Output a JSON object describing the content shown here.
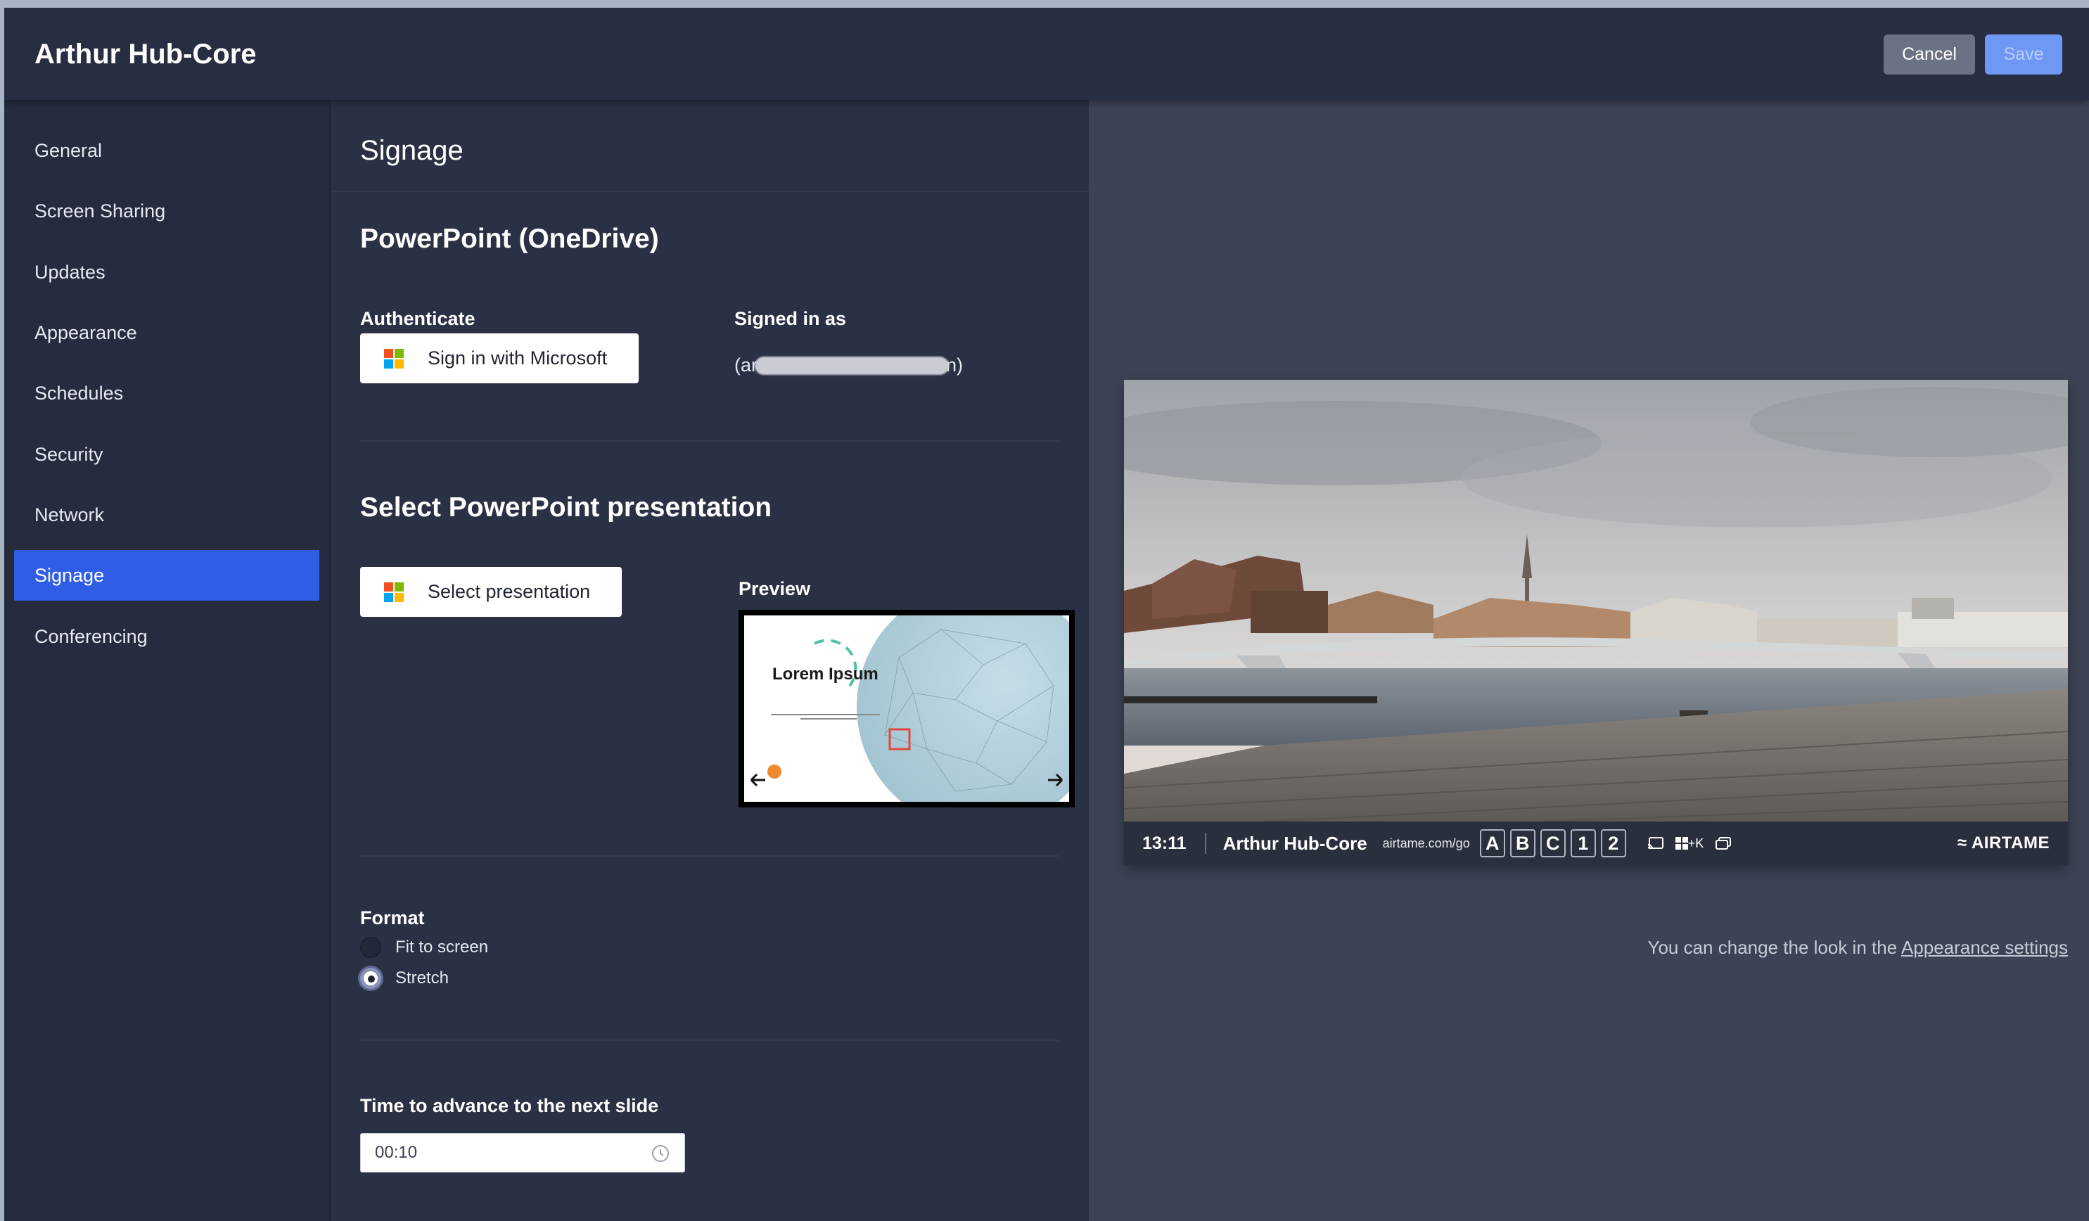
{
  "header": {
    "title": "Arthur Hub-Core",
    "cancel_label": "Cancel",
    "save_label": "Save"
  },
  "sidebar": {
    "items": [
      {
        "label": "General"
      },
      {
        "label": "Screen Sharing"
      },
      {
        "label": "Updates"
      },
      {
        "label": "Appearance"
      },
      {
        "label": "Schedules"
      },
      {
        "label": "Security"
      },
      {
        "label": "Network"
      },
      {
        "label": "Signage",
        "active": true
      },
      {
        "label": "Conferencing"
      }
    ]
  },
  "signage": {
    "title": "Signage",
    "powerpoint_heading": "PowerPoint (OneDrive)",
    "authenticate_label": "Authenticate",
    "sign_in_label": "Sign in with Microsoft",
    "signed_in_label": "Signed in as",
    "signed_in_prefix": "(ar",
    "signed_in_suffix": "n)",
    "select_heading": "Select PowerPoint presentation",
    "select_button_label": "Select presentation",
    "preview_label": "Preview",
    "slide_title": "Lorem Ipsum",
    "format_label": "Format",
    "format_options": [
      {
        "label": "Fit to screen",
        "checked": false
      },
      {
        "label": "Stretch",
        "checked": true
      }
    ],
    "advance_label": "Time to advance to the next slide",
    "advance_value": "00:10"
  },
  "screen_preview": {
    "time": "13:11",
    "device_name": "Arthur Hub-Core",
    "url": "airtame.com/go",
    "keys": [
      "A",
      "B",
      "C",
      "1",
      "2"
    ],
    "shortcut_text": "+K",
    "brand": "AIRTAME",
    "hint_text": "You can change the look in the ",
    "hint_link": "Appearance settings"
  },
  "colors": {
    "accent": "#2f5de5",
    "save_button": "#6f97f5",
    "cancel_button": "#6b7283",
    "panel_bg": "#2b3144",
    "preview_bg": "#3d4354"
  }
}
